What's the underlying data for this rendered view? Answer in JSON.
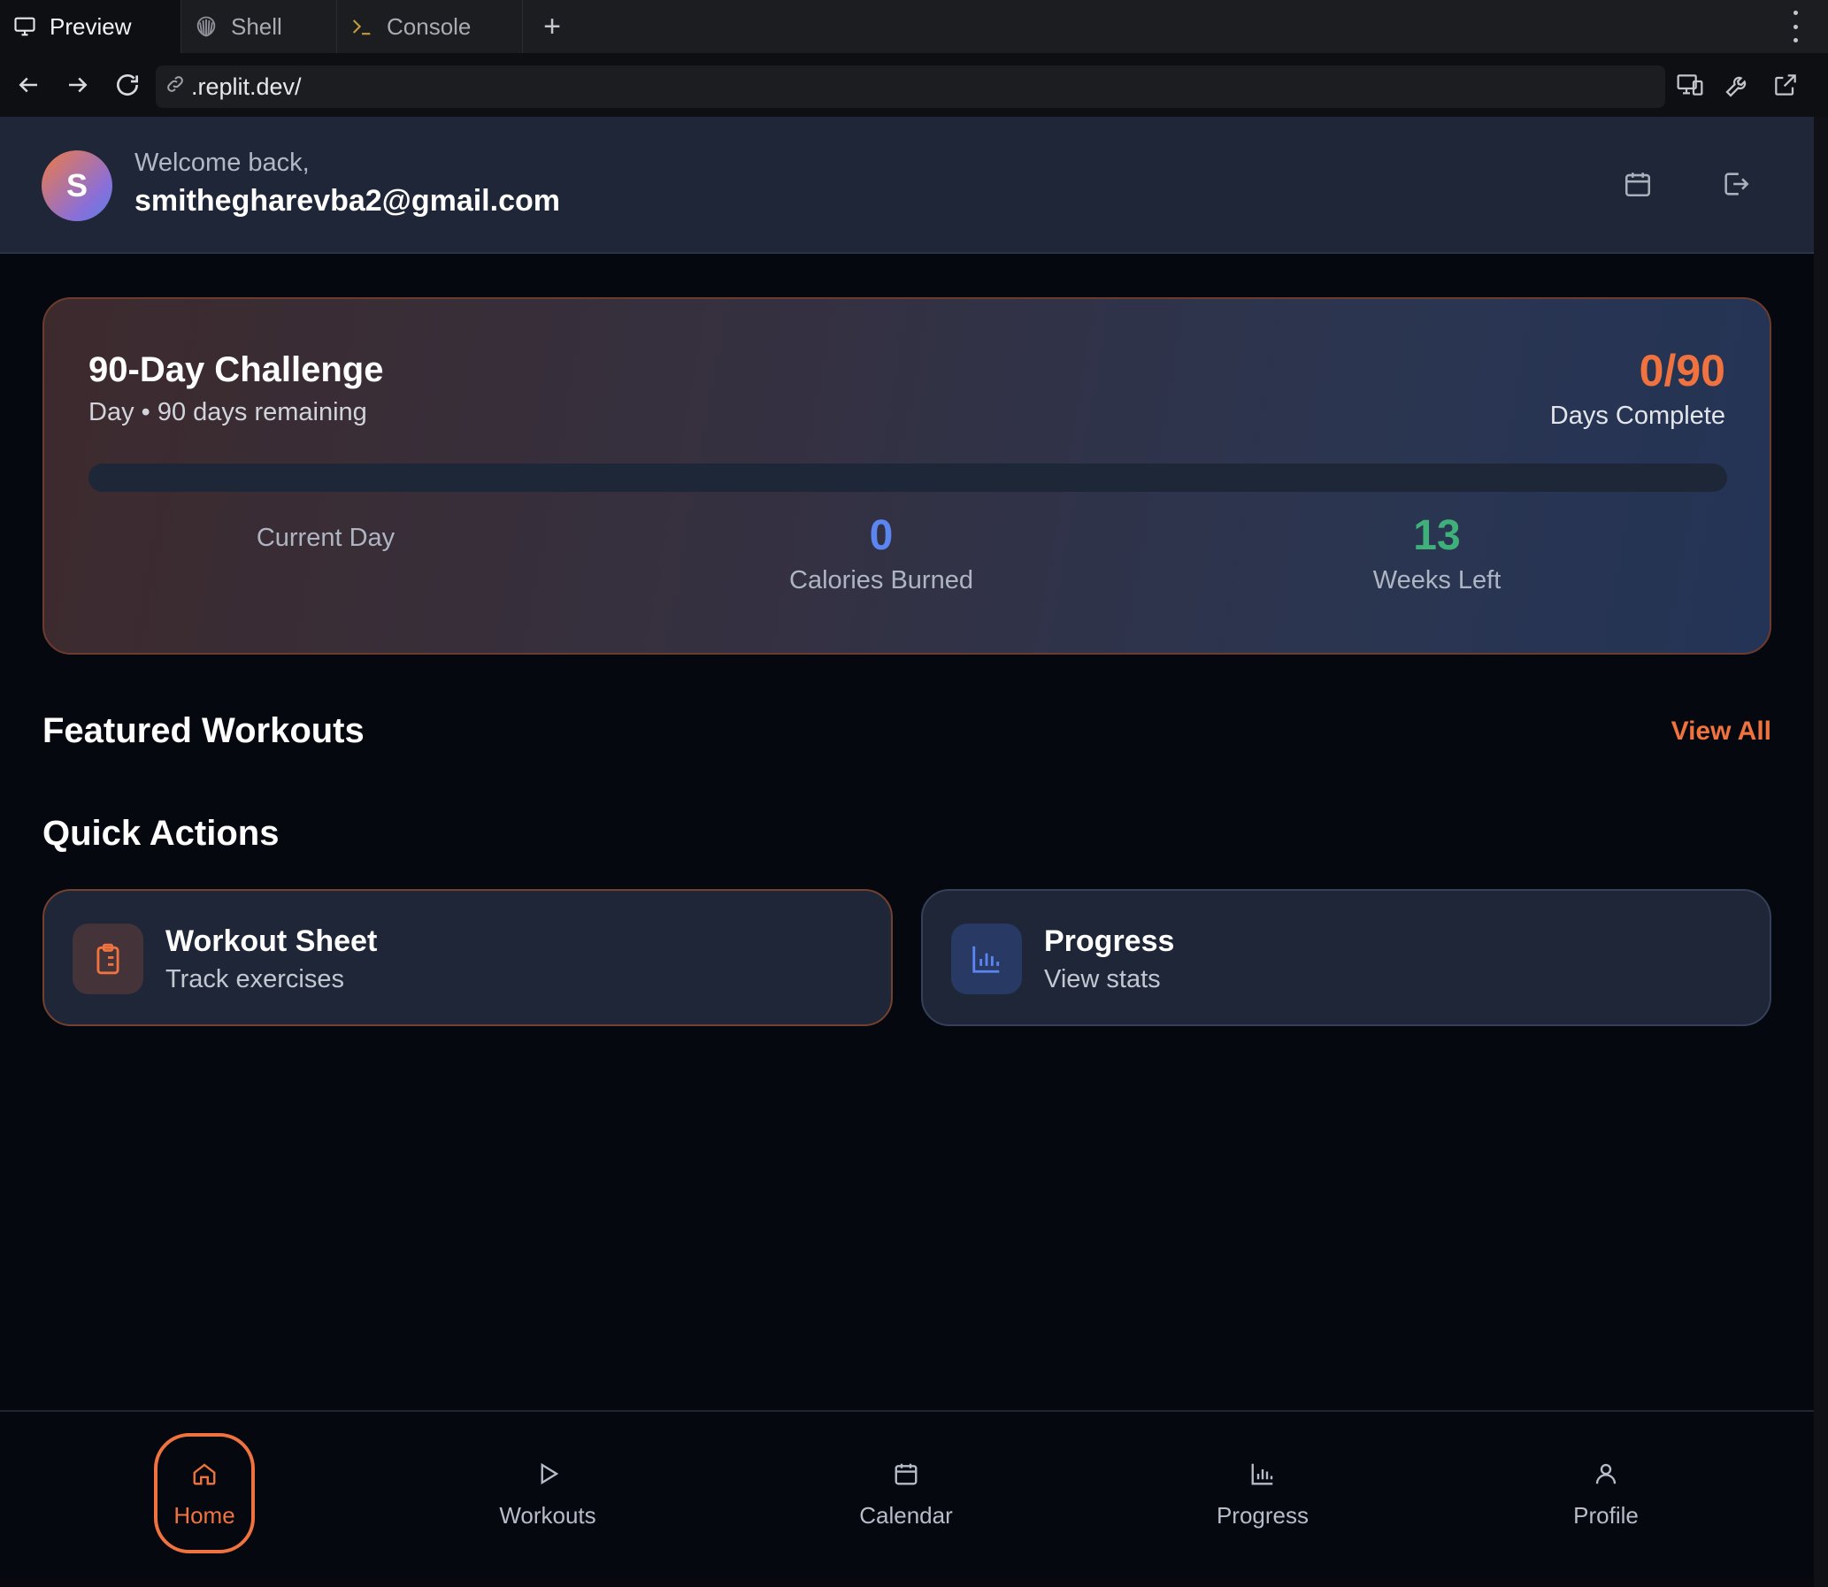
{
  "browser": {
    "tabs": [
      {
        "label": "Preview",
        "icon": "monitor-icon",
        "active": true
      },
      {
        "label": "Shell",
        "icon": "shell-icon",
        "active": false
      },
      {
        "label": "Console",
        "icon": "terminal-icon",
        "active": false
      }
    ],
    "add_tab_label": "+",
    "url": ".replit.dev/"
  },
  "header": {
    "avatar_initial": "S",
    "welcome": "Welcome back,",
    "email": "smithegharevba2@gmail.com"
  },
  "challenge": {
    "title": "90-Day Challenge",
    "subtitle": "Day • 90 days remaining",
    "count": "0/90",
    "count_label": "Days Complete",
    "progress_fraction": 0,
    "stats": {
      "current_day_label": "Current Day",
      "calories_value": "0",
      "calories_label": "Calories Burned",
      "weeks_value": "13",
      "weeks_label": "Weeks Left"
    }
  },
  "featured": {
    "title": "Featured Workouts",
    "view_all": "View All"
  },
  "quick_actions": {
    "title": "Quick Actions",
    "items": [
      {
        "title": "Workout Sheet",
        "subtitle": "Track exercises",
        "icon": "clipboard-icon"
      },
      {
        "title": "Progress",
        "subtitle": "View stats",
        "icon": "bar-chart-icon"
      }
    ]
  },
  "bottom_nav": [
    {
      "label": "Home",
      "icon": "home-icon",
      "active": true
    },
    {
      "label": "Workouts",
      "icon": "play-icon",
      "active": false
    },
    {
      "label": "Calendar",
      "icon": "calendar-icon",
      "active": false
    },
    {
      "label": "Progress",
      "icon": "bar-chart-icon",
      "active": false
    },
    {
      "label": "Profile",
      "icon": "user-icon",
      "active": false
    }
  ],
  "colors": {
    "accent": "#f0733f",
    "blue": "#5b85f0",
    "green": "#3fb07a",
    "card_bg": "#1e2637",
    "page_bg": "#05080f"
  }
}
